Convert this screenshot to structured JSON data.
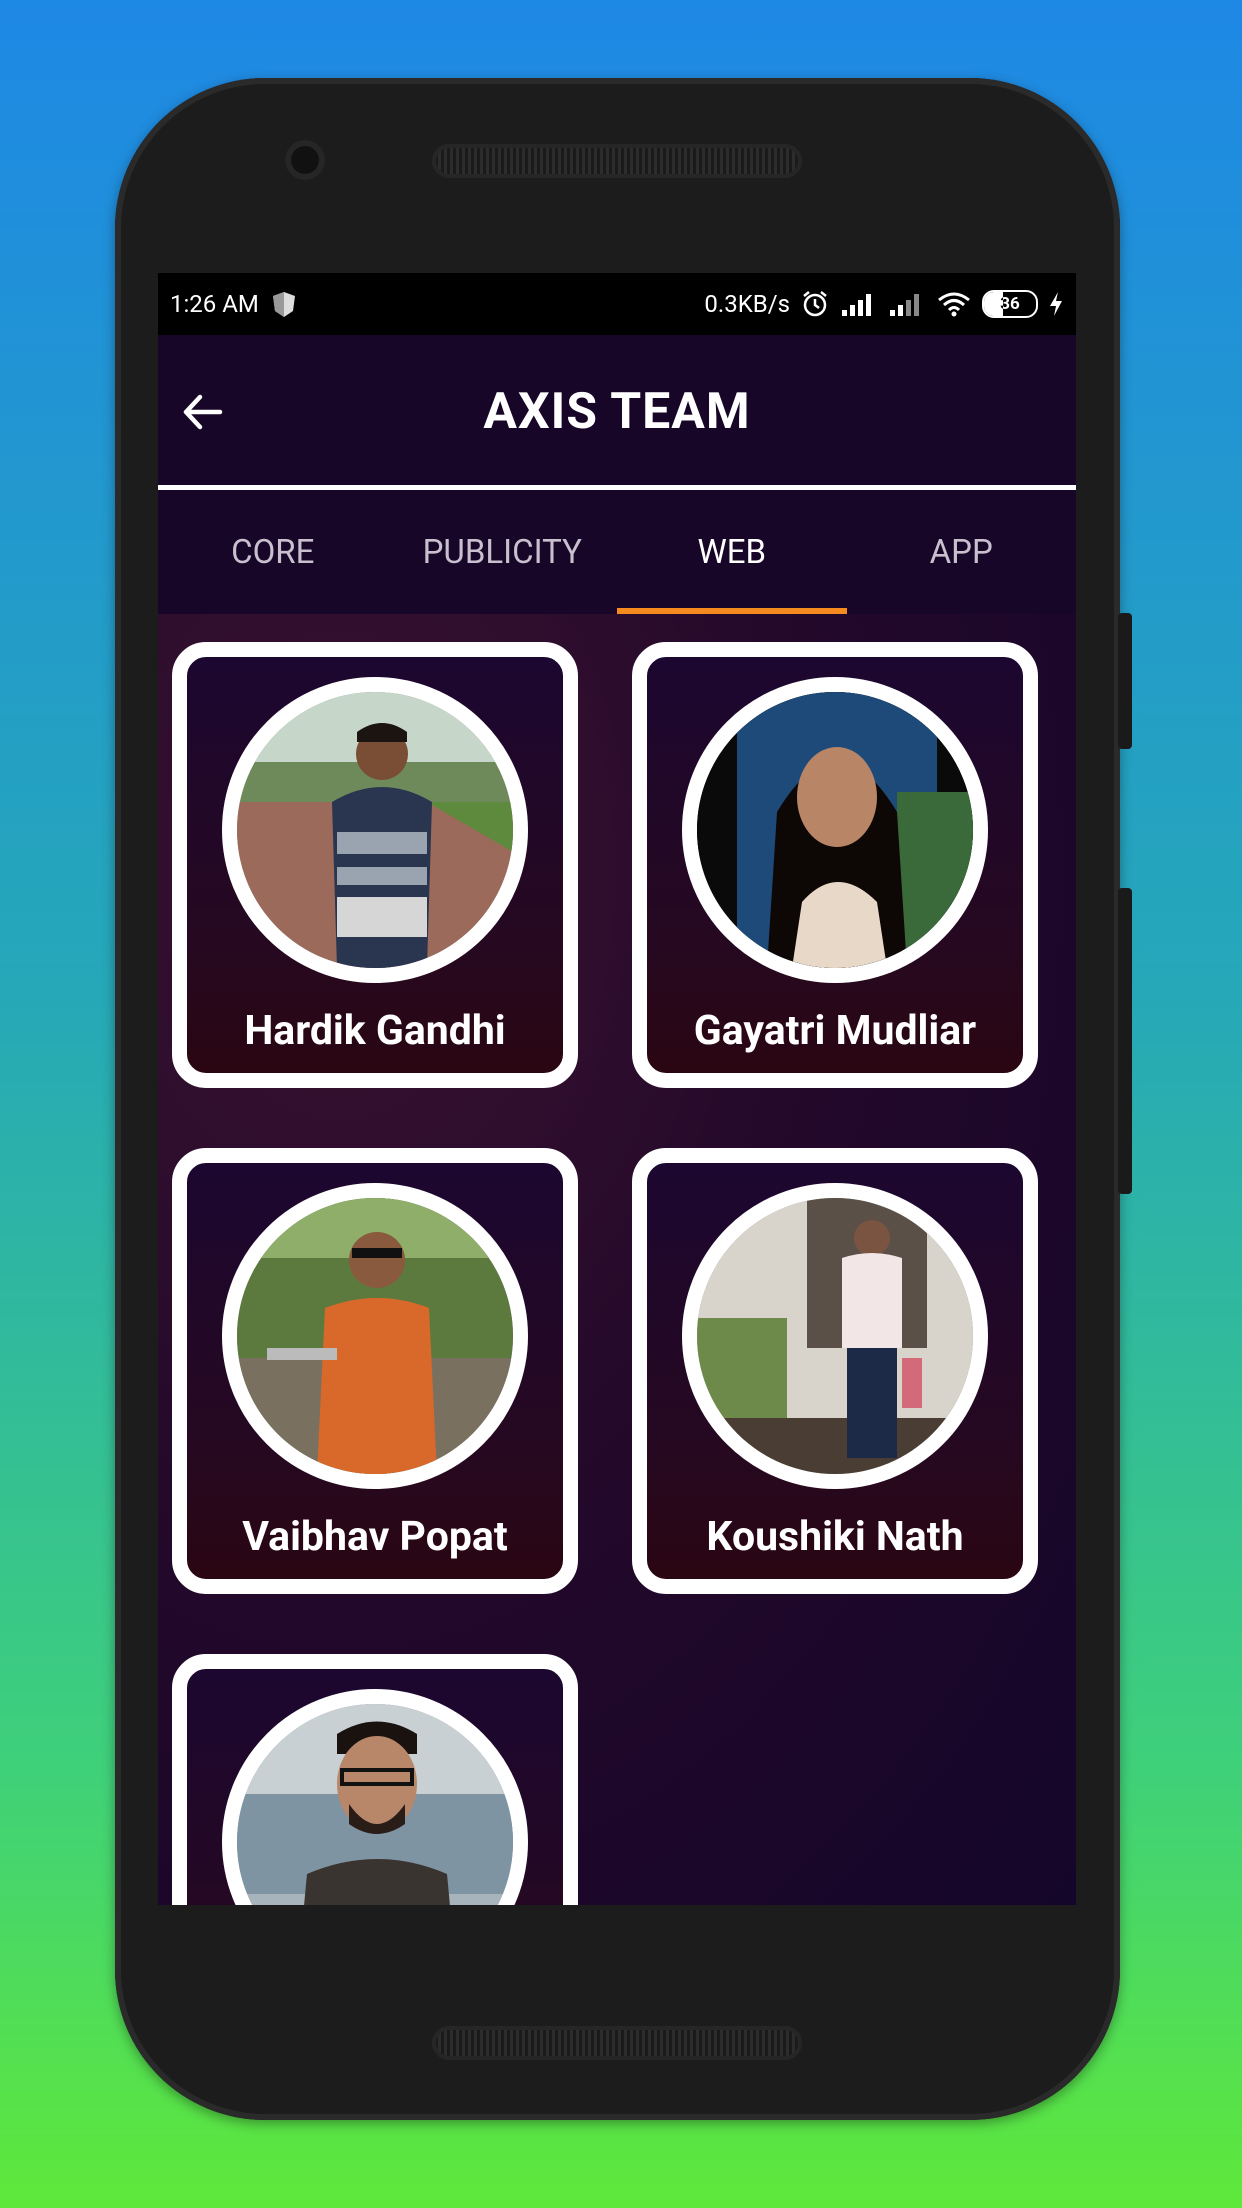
{
  "status_bar": {
    "time": "1:26 AM",
    "network_speed": "0.3KB/s",
    "battery": "36"
  },
  "app_bar": {
    "title": "AXIS TEAM",
    "back_icon": "arrow-left-icon"
  },
  "tabs": [
    {
      "label": "CORE",
      "active": false
    },
    {
      "label": "PUBLICITY",
      "active": false
    },
    {
      "label": "WEB",
      "active": true
    },
    {
      "label": "APP",
      "active": false
    }
  ],
  "members": [
    {
      "name": "Hardik Gandhi"
    },
    {
      "name": "Gayatri Mudliar"
    },
    {
      "name": "Vaibhav Popat"
    },
    {
      "name": "Koushiki Nath"
    },
    {
      "name": ""
    }
  ],
  "colors": {
    "accent": "#f58a1e",
    "background": "#180628"
  }
}
